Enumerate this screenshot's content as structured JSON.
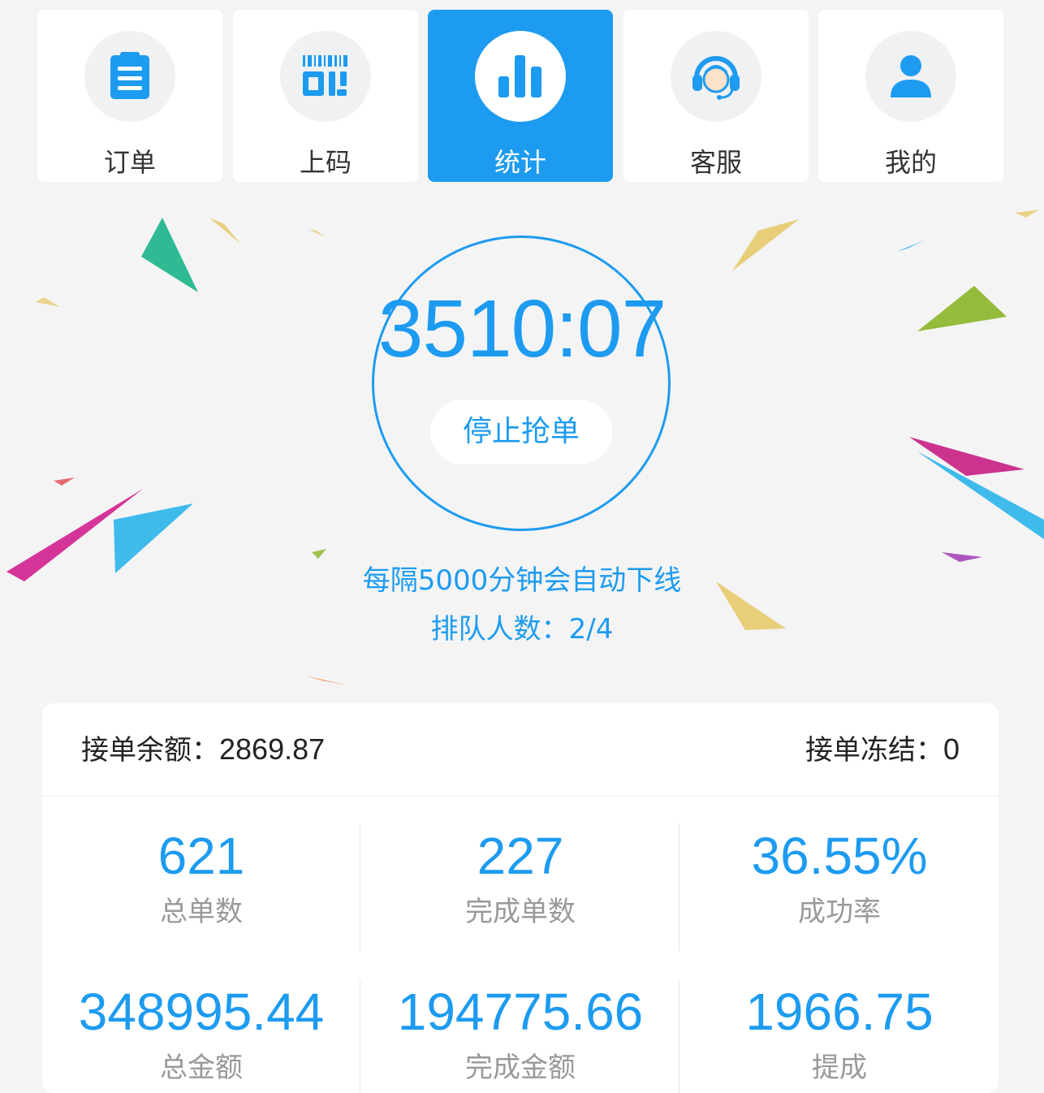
{
  "nav": {
    "items": [
      {
        "label": "订单",
        "icon": "clipboard-icon"
      },
      {
        "label": "上码",
        "icon": "barcode-icon"
      },
      {
        "label": "统计",
        "icon": "bar-chart-icon",
        "active": true
      },
      {
        "label": "客服",
        "icon": "headset-icon"
      },
      {
        "label": "我的",
        "icon": "user-icon"
      }
    ]
  },
  "timer": {
    "value": "3510:07",
    "stop_label": "停止抢单"
  },
  "notice": {
    "auto_offline": "每隔5000分钟会自动下线",
    "queue": "排队人数：2/4"
  },
  "balance": {
    "left_label": "接单余额：",
    "left_value": "2869.87",
    "right_label": "接单冻结：",
    "right_value": "0"
  },
  "stats": [
    {
      "value": "621",
      "label": "总单数"
    },
    {
      "value": "227",
      "label": "完成单数"
    },
    {
      "value": "36.55%",
      "label": "成功率"
    },
    {
      "value": "348995.44",
      "label": "总金额"
    },
    {
      "value": "194775.66",
      "label": "完成金额"
    },
    {
      "value": "1966.75",
      "label": "提成"
    }
  ],
  "colors": {
    "accent": "#1d9bf0",
    "background": "#f4f4f5",
    "muted_text": "#999999"
  }
}
